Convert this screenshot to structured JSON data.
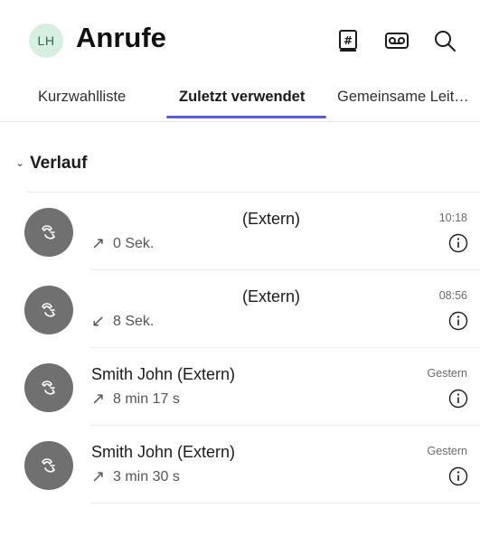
{
  "header": {
    "avatar_initials": "LH",
    "title": "Anrufe",
    "icons": [
      "dialpad-book-icon",
      "voicemail-icon",
      "search-icon"
    ]
  },
  "tabs": [
    {
      "label": "Kurzwahlliste",
      "active": false
    },
    {
      "label": "Zuletzt verwendet",
      "active": true
    },
    {
      "label": "Gemeinsame Leit…",
      "active": false
    }
  ],
  "section": {
    "label": "Verlauf"
  },
  "calls": [
    {
      "name": "(Extern)",
      "direction": "outgoing",
      "arrow": "↗",
      "duration": "0 Sek.",
      "time": "10:18"
    },
    {
      "name": "(Extern)",
      "direction": "incoming",
      "arrow": "↙",
      "duration": "8 Sek.",
      "time": "08:56"
    },
    {
      "name": "Smith John (Extern)",
      "direction": "outgoing",
      "arrow": "↗",
      "duration": "8 min 17 s",
      "time": "Gestern"
    },
    {
      "name": "Smith John (Extern)",
      "direction": "outgoing",
      "arrow": "↗",
      "duration": "3 min 30 s",
      "time": "Gestern"
    }
  ],
  "colors": {
    "accent": "#5b5fc7",
    "avatar_bg": "#707070",
    "initials_bg": "#d5efe0"
  }
}
